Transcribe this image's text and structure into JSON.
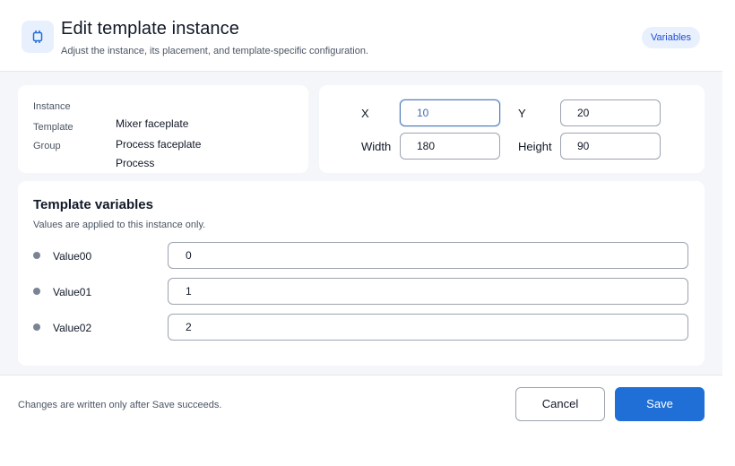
{
  "header": {
    "icon": "chip-icon",
    "title": "Edit template instance",
    "subtitle": "Adjust the instance, its placement, and template-specific configuration.",
    "badge": "Variables",
    "accent_color": "#1f6fd6"
  },
  "info": {
    "instance_label": "Instance",
    "instance_value": "Mixer faceplate",
    "template_label": "Template",
    "template_value": "Process faceplate",
    "group_label": "Group",
    "group_value": "Process"
  },
  "position": {
    "x_label": "X",
    "x_value": "10",
    "y_label": "Y",
    "y_value": "20",
    "width_label": "Width",
    "width_value": "180",
    "height_label": "Height",
    "height_value": "90"
  },
  "variables": {
    "title": "Template variables",
    "subtitle": "Values are applied to this instance only.",
    "items": [
      {
        "name": "Value00",
        "value": "0"
      },
      {
        "name": "Value01",
        "value": "1"
      },
      {
        "name": "Value02",
        "value": "2"
      }
    ]
  },
  "footer": {
    "note": "Changes are written only after Save succeeds.",
    "cancel_label": "Cancel",
    "save_label": "Save"
  }
}
